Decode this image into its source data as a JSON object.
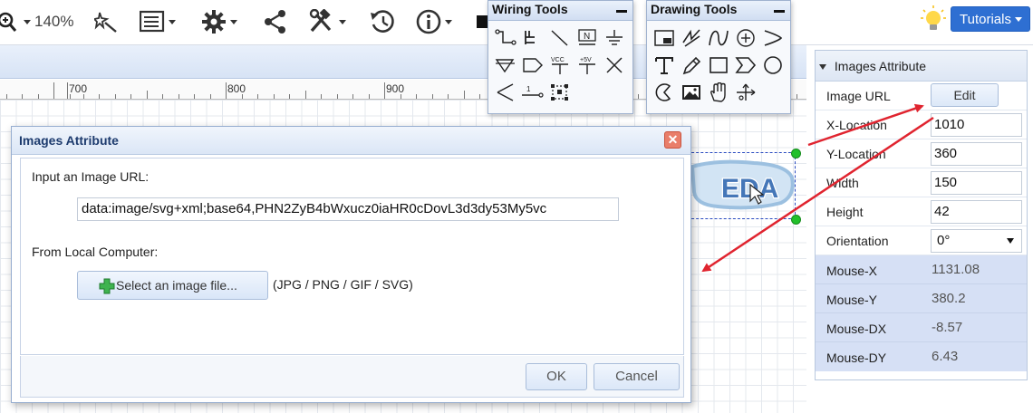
{
  "toolbar": {
    "zoom_label": "140%",
    "tutorials_label": "Tutorials"
  },
  "ruler": {
    "labels": [
      "700",
      "800",
      "900"
    ]
  },
  "wiring_tools": {
    "title": "Wiring Tools",
    "icons": [
      "wire-icon",
      "bus-icon",
      "bus-entry-icon",
      "net-label-icon",
      "ground-icon",
      "net-port-icon",
      "net-flag-icon",
      "vcc-icon",
      "plus-5v-icon",
      "no-connect-flag-icon",
      "voltage-probe-icon",
      "pin-icon",
      "group-ungroup-icon"
    ],
    "vcc_text": "VCC",
    "p5v_text": "+5V",
    "n_text": "N",
    "pin_text": "1"
  },
  "drawing_tools": {
    "title": "Drawing Tools",
    "icons": [
      "label-box-icon",
      "polyline-icon",
      "bezier-icon",
      "arc-icon",
      "freehand-arc-icon",
      "text-icon",
      "pencil-icon",
      "rectangle-icon",
      "polygon-icon",
      "ellipse-icon",
      "pie-icon",
      "image-icon",
      "drag-hand-icon",
      "canvas-origin-icon"
    ]
  },
  "attributes_panel": {
    "title": "Images Attribute",
    "rows": [
      {
        "label": "Image URL",
        "type": "button",
        "value": "Edit"
      },
      {
        "label": "X-Location",
        "type": "input",
        "value": "1010"
      },
      {
        "label": "Y-Location",
        "type": "input",
        "value": "360"
      },
      {
        "label": "Width",
        "type": "input",
        "value": "150"
      },
      {
        "label": "Height",
        "type": "input",
        "value": "42"
      },
      {
        "label": "Orientation",
        "type": "select",
        "value": "0°"
      }
    ],
    "mouse": [
      {
        "label": "Mouse-X",
        "value": "1131.08"
      },
      {
        "label": "Mouse-Y",
        "value": "380.2"
      },
      {
        "label": "Mouse-DX",
        "value": "-8.57"
      },
      {
        "label": "Mouse-DY",
        "value": "6.43"
      }
    ]
  },
  "canvas": {
    "logo_text": "EDA"
  },
  "dialog": {
    "title": "Images Attribute",
    "url_label": "Input an Image URL:",
    "url_value": "data:image/svg+xml;base64,PHN2ZyB4bWxucz0iaHR0cDovL3d3dy53My5vc",
    "local_label": "From Local Computer:",
    "file_button": "Select an image file...",
    "file_hint": "(JPG / PNG / GIF / SVG)",
    "ok_label": "OK",
    "cancel_label": "Cancel"
  },
  "colors": {
    "accent": "#2e6fd2",
    "arrow": "#e0242f",
    "mouse_panel": "#d6e0f5",
    "handle": "#22c02a"
  }
}
